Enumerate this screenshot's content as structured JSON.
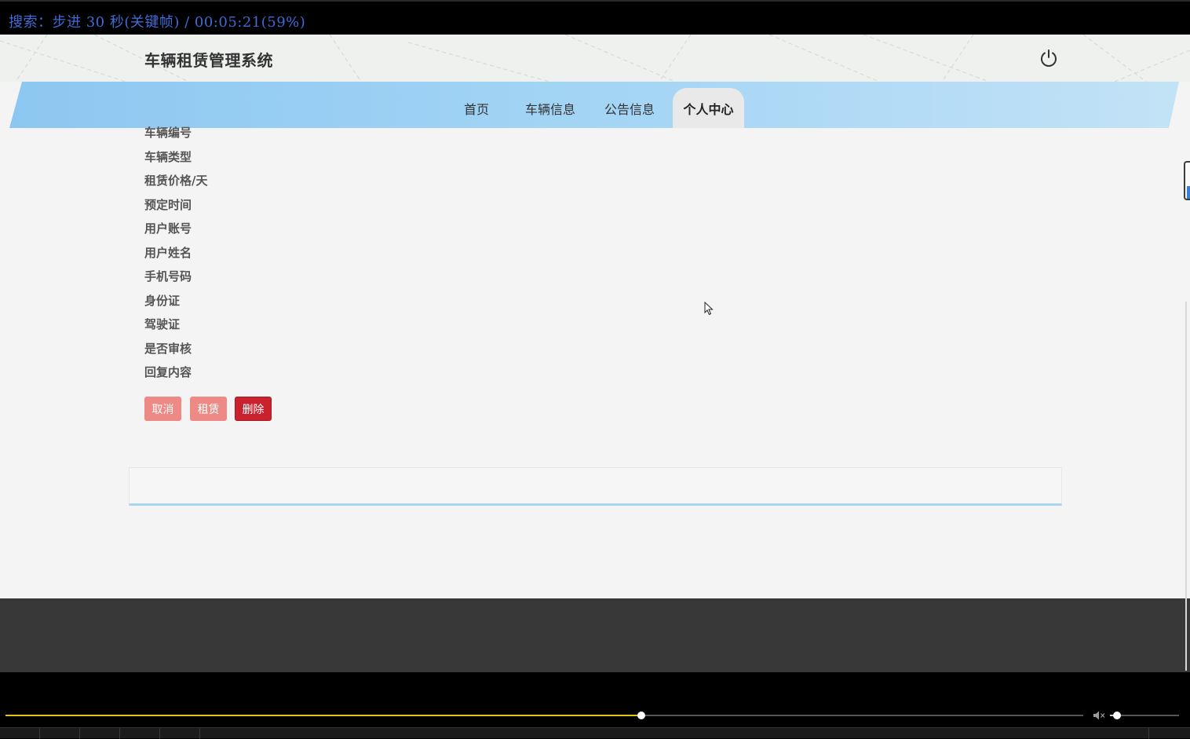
{
  "osd": {
    "text": "搜索：步进 30 秒(关键帧) / 00:05:21(59%)"
  },
  "site": {
    "title": "车辆租赁管理系统"
  },
  "nav": {
    "items": [
      {
        "label": "首页"
      },
      {
        "label": "车辆信息"
      },
      {
        "label": "公告信息"
      },
      {
        "label": "个人中心",
        "active": true
      }
    ]
  },
  "detail": {
    "labels": [
      "车辆编号",
      "车辆类型",
      "租赁价格/天",
      "预定时间",
      "用户账号",
      "用户姓名",
      "手机号码",
      "身份证",
      "驾驶证",
      "是否审核",
      "回复内容"
    ]
  },
  "actions": {
    "cancel_label": "取消",
    "rent_label": "租赁",
    "delete_label": "删除"
  },
  "player": {
    "progress_percent": 59,
    "volume_percent": 10
  },
  "colors": {
    "osd_text": "#3f6bd6",
    "nav_band": "#9fd0f2",
    "btn_light": "#ee8a85",
    "btn_danger": "#c9222e",
    "seek_fill": "#e3c613",
    "footer": "#383838"
  },
  "icons": {
    "power": "power-icon",
    "cursor": "mouse-pointer-icon",
    "volume": "volume-icon"
  }
}
